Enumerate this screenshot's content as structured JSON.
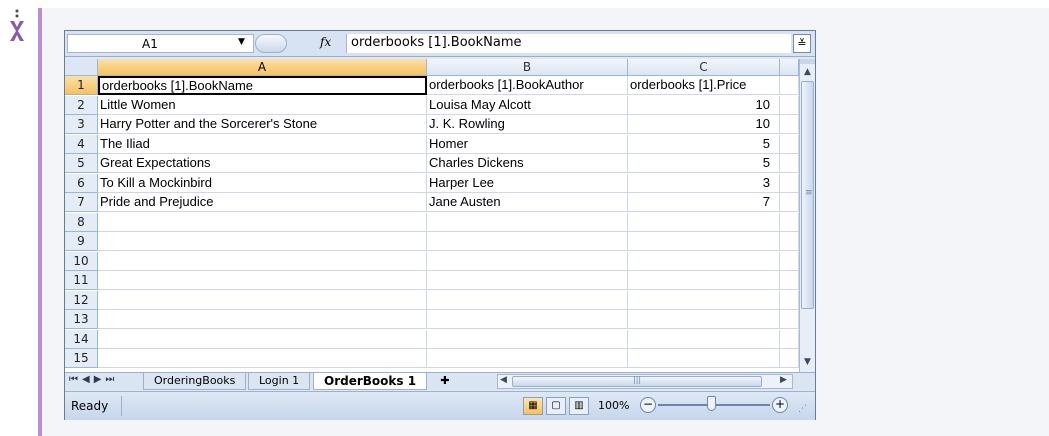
{
  "name_box": {
    "value": "A1"
  },
  "formula_bar": {
    "fx_label": "fx",
    "formula": "orderbooks [1].BookName"
  },
  "columns": [
    {
      "label": "A",
      "selected": true
    },
    {
      "label": "B",
      "selected": false
    },
    {
      "label": "C",
      "selected": false
    }
  ],
  "rows": [
    {
      "num": "1",
      "a": "orderbooks [1].BookName",
      "b": "orderbooks [1].BookAuthor",
      "c": "orderbooks [1].Price"
    },
    {
      "num": "2",
      "a": "Little Women",
      "b": "Louisa May Alcott",
      "c": "10"
    },
    {
      "num": "3",
      "a": "Harry Potter and the Sorcerer's Stone",
      "b": "J. K. Rowling",
      "c": "10"
    },
    {
      "num": "4",
      "a": "The Iliad",
      "b": "Homer",
      "c": "5"
    },
    {
      "num": "5",
      "a": "Great Expectations",
      "b": "Charles Dickens",
      "c": "5"
    },
    {
      "num": "6",
      "a": "To Kill a Mockinbird",
      "b": "Harper Lee",
      "c": "3"
    },
    {
      "num": "7",
      "a": "Pride and Prejudice",
      "b": "Jane Austen",
      "c": "7"
    },
    {
      "num": "8",
      "a": "",
      "b": "",
      "c": ""
    },
    {
      "num": "9",
      "a": "",
      "b": "",
      "c": ""
    },
    {
      "num": "10",
      "a": "",
      "b": "",
      "c": ""
    },
    {
      "num": "11",
      "a": "",
      "b": "",
      "c": ""
    },
    {
      "num": "12",
      "a": "",
      "b": "",
      "c": ""
    },
    {
      "num": "13",
      "a": "",
      "b": "",
      "c": ""
    },
    {
      "num": "14",
      "a": "",
      "b": "",
      "c": ""
    },
    {
      "num": "15",
      "a": "",
      "b": "",
      "c": ""
    }
  ],
  "sheet_tabs": [
    {
      "label": "OrderingBooks",
      "active": false
    },
    {
      "label": "Login 1",
      "active": false
    },
    {
      "label": "OrderBooks 1",
      "active": true
    }
  ],
  "status": {
    "ready": "Ready",
    "zoom": "100%"
  },
  "colors": {
    "accent_bar": "#b98fd0",
    "selected_header": "#f6c25f"
  }
}
